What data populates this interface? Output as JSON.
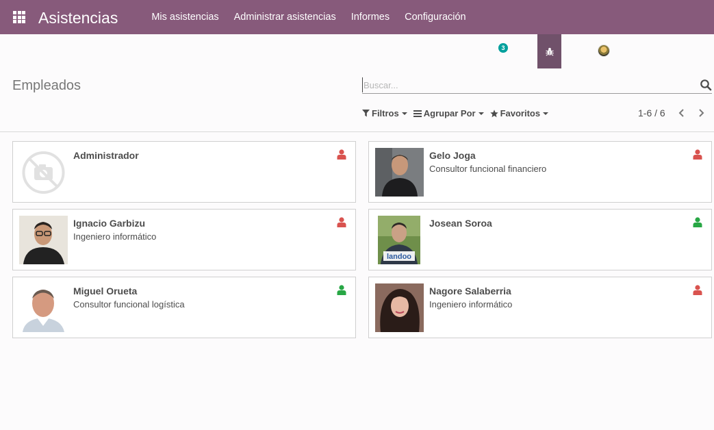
{
  "app": {
    "title": "Asistencias",
    "menu": [
      "Mis asistencias",
      "Administrar asistencias",
      "Informes",
      "Configuración"
    ]
  },
  "systray": {
    "messages_count": "3",
    "icons": [
      "apps-grid-icon",
      "chat-badge",
      "bug-icon",
      "user-avatar"
    ]
  },
  "control_panel": {
    "title": "Empleados",
    "search_placeholder": "Buscar...",
    "filters_label": "Filtros",
    "group_label": "Agrupar Por",
    "favorites_label": "Favoritos",
    "pager": "1-6 / 6"
  },
  "colors": {
    "brand": "#875a7b",
    "debug_active": "#70516a",
    "present": "#28a745",
    "absent": "#d9534f",
    "badge": "#00a09d"
  },
  "employees": [
    {
      "name": "Administrador",
      "job": "",
      "status": "absent",
      "photo": "placeholder"
    },
    {
      "name": "Gelo Joga",
      "job": "Consultor funcional financiero",
      "status": "absent",
      "photo": "person"
    },
    {
      "name": "Ignacio Garbizu",
      "job": "Ingeniero informático",
      "status": "absent",
      "photo": "person"
    },
    {
      "name": "Josean Soroa",
      "job": "",
      "status": "present",
      "photo": "person-logo",
      "photo_logo_text": "landoo"
    },
    {
      "name": "Miguel Orueta",
      "job": "Consultor funcional logística",
      "status": "present",
      "photo": "person"
    },
    {
      "name": "Nagore Salaberria",
      "job": "Ingeniero informático",
      "status": "absent",
      "photo": "person"
    }
  ]
}
